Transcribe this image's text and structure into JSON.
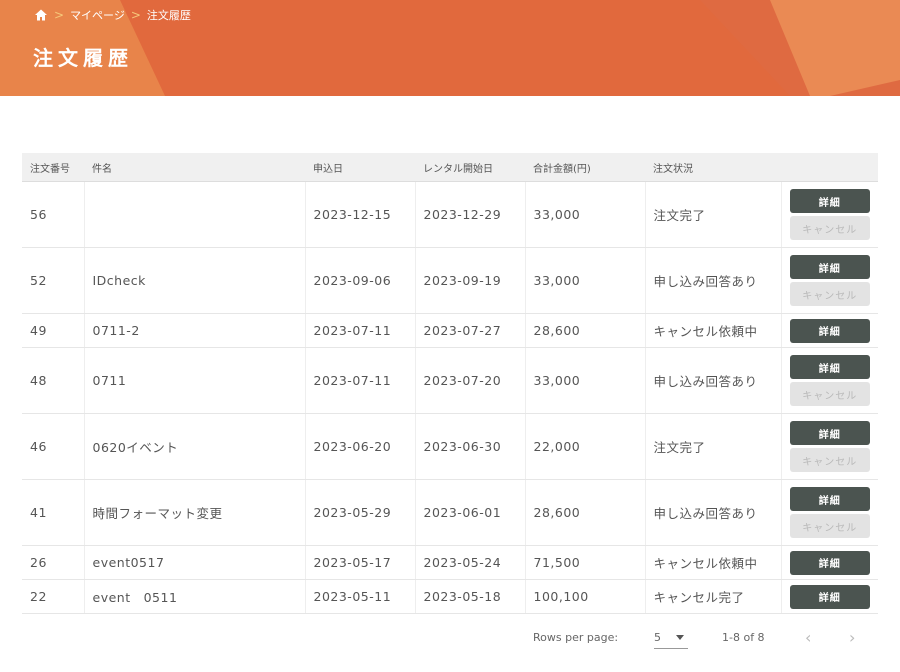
{
  "breadcrumb": {
    "items": [
      "マイページ",
      "注文履歴"
    ]
  },
  "page_title": "注文履歴",
  "table": {
    "headers": [
      "注文番号",
      "件名",
      "申込日",
      "レンタル開始日",
      "合計金額(円)",
      "注文状況",
      ""
    ],
    "rows": [
      {
        "id": "56",
        "name": "",
        "applied": "2023-12-15",
        "start": "2023-12-29",
        "total": "33,000",
        "status": "注文完了",
        "cancel": true
      },
      {
        "id": "52",
        "name": "IDcheck",
        "applied": "2023-09-06",
        "start": "2023-09-19",
        "total": "33,000",
        "status": "申し込み回答あり",
        "cancel": true
      },
      {
        "id": "49",
        "name": "0711-2",
        "applied": "2023-07-11",
        "start": "2023-07-27",
        "total": "28,600",
        "status": "キャンセル依頼中",
        "cancel": false
      },
      {
        "id": "48",
        "name": "0711",
        "applied": "2023-07-11",
        "start": "2023-07-20",
        "total": "33,000",
        "status": "申し込み回答あり",
        "cancel": true
      },
      {
        "id": "46",
        "name": "0620イベント",
        "applied": "2023-06-20",
        "start": "2023-06-30",
        "total": "22,000",
        "status": "注文完了",
        "cancel": true
      },
      {
        "id": "41",
        "name": "時間フォーマット変更",
        "applied": "2023-05-29",
        "start": "2023-06-01",
        "total": "28,600",
        "status": "申し込み回答あり",
        "cancel": true
      },
      {
        "id": "26",
        "name": "event0517",
        "applied": "2023-05-17",
        "start": "2023-05-24",
        "total": "71,500",
        "status": "キャンセル依頼中",
        "cancel": false
      },
      {
        "id": "22",
        "name": "event　0511",
        "applied": "2023-05-11",
        "start": "2023-05-18",
        "total": "100,100",
        "status": "キャンセル完了",
        "cancel": false
      }
    ],
    "detail_label": "詳細",
    "cancel_label": "キャンセル"
  },
  "pagination": {
    "rows_per_page_label": "Rows per page:",
    "rows_per_page": "5",
    "range": "1-8 of 8"
  },
  "colors": {
    "header_orange": "#e1693d",
    "detail_button": "#4b5450",
    "cancel_button_disabled": "#e3e3e3"
  }
}
